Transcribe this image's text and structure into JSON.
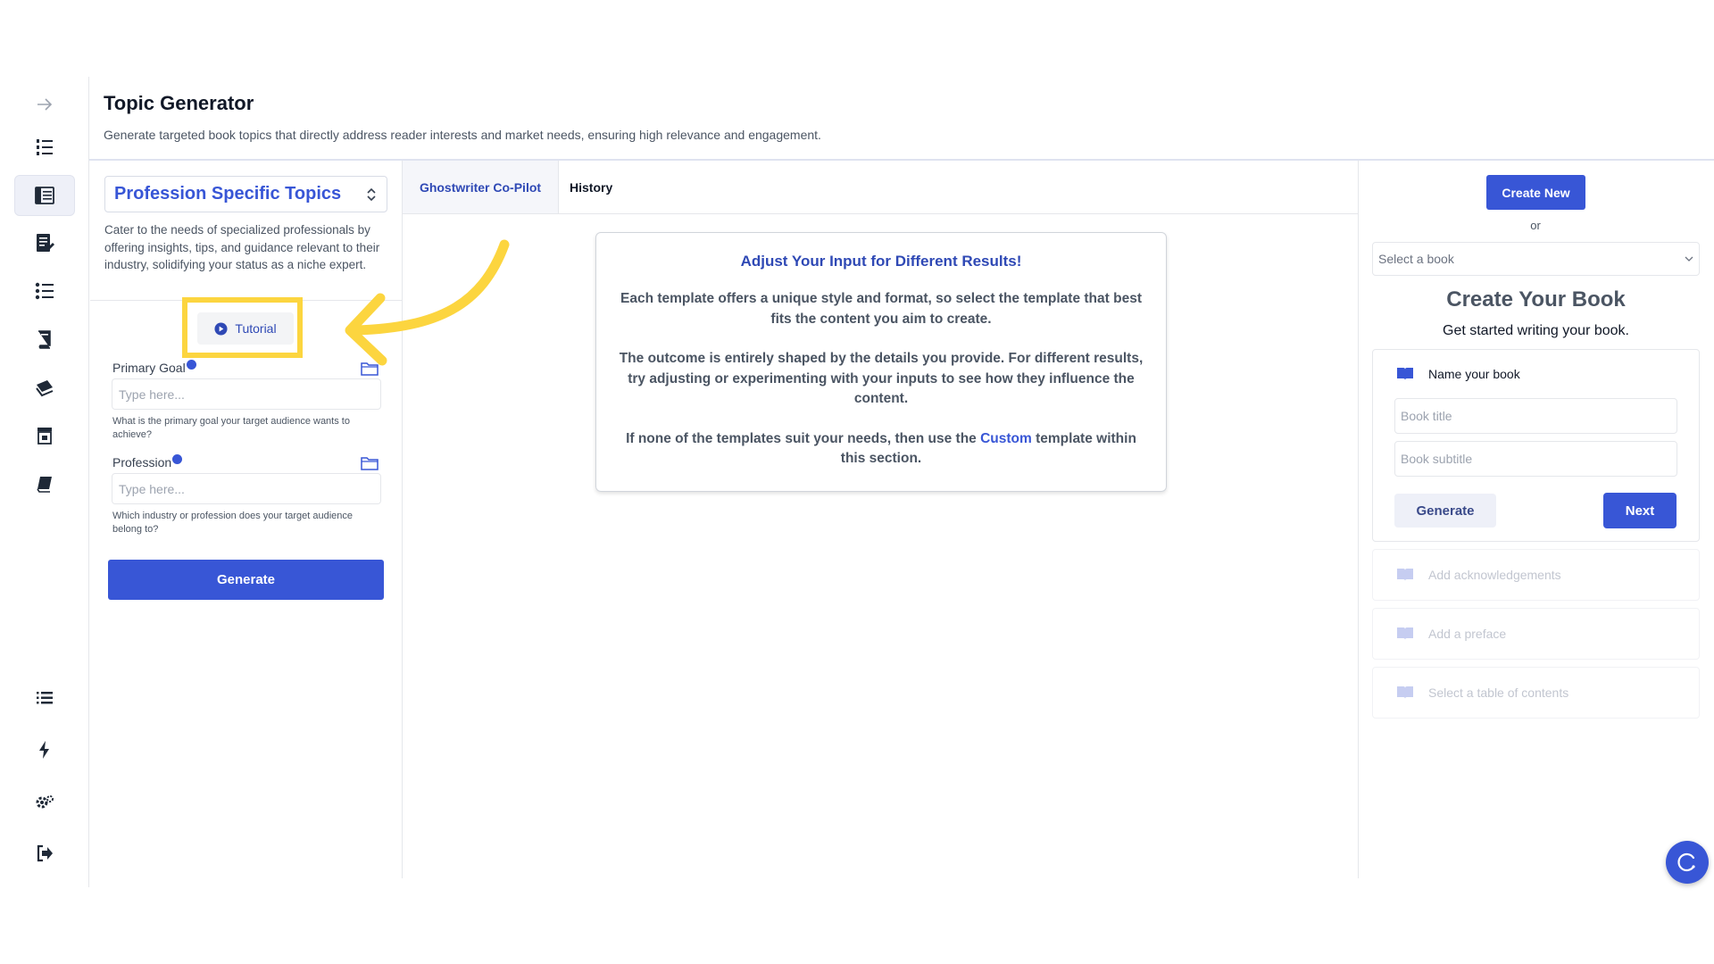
{
  "header": {
    "title": "Topic Generator",
    "description": "Generate targeted book topics that directly address reader interests and market needs, ensuring high relevance and engagement."
  },
  "sidebar": {
    "items": [
      {
        "icon": "arrow-right-icon"
      },
      {
        "icon": "numbered-list-icon"
      },
      {
        "icon": "topic-generator-icon",
        "active": true
      },
      {
        "icon": "edit-document-icon"
      },
      {
        "icon": "outline-list-icon"
      },
      {
        "icon": "book-stack-icon"
      },
      {
        "icon": "books-icon"
      },
      {
        "icon": "store-icon"
      },
      {
        "icon": "book-icon"
      },
      {
        "icon": "list-icon"
      },
      {
        "icon": "lightning-icon"
      },
      {
        "icon": "settings-icon"
      },
      {
        "icon": "logout-icon"
      }
    ]
  },
  "template": {
    "selected": "Profession Specific Topics",
    "description": "Cater to the needs of specialized professionals by offering insights, tips, and guidance relevant to their industry, solidifying your status as a niche expert.",
    "tutorial_label": "Tutorial",
    "fields": [
      {
        "label": "Primary Goal",
        "placeholder": "Type here...",
        "help": "What is the primary goal your target audience wants to achieve?"
      },
      {
        "label": "Profession",
        "placeholder": "Type here...",
        "help": "Which industry or profession does your target audience belong to?"
      }
    ],
    "generate_label": "Generate"
  },
  "workspace": {
    "tabs": [
      {
        "label": "Ghostwriter Co-Pilot",
        "active": true
      },
      {
        "label": "History",
        "active": false
      }
    ],
    "card": {
      "title": "Adjust Your Input for Different Results!",
      "p1": "Each template offers a unique style and format, so select the template that best fits the content you aim to create.",
      "p2": "The outcome is entirely shaped by the details you provide. For different results, try adjusting or experimenting with your inputs to see how they influence the content.",
      "p3_before": "If none of the templates suit your needs, then use the ",
      "p3_link": "Custom",
      "p3_after": " template within this section."
    }
  },
  "book_panel": {
    "create_new_label": "Create New",
    "or_label": "or",
    "select_placeholder": "Select a book",
    "title": "Create Your Book",
    "subtitle": "Get started writing your book.",
    "step_name": "Name your book",
    "title_placeholder": "Book title",
    "subtitle_placeholder": "Book subtitle",
    "generate_label": "Generate",
    "next_label": "Next",
    "next_steps": [
      "Add acknowledgements",
      "Add a preface",
      "Select a table of contents"
    ]
  },
  "colors": {
    "accent": "#3856d6",
    "highlight": "#fcd53f"
  }
}
